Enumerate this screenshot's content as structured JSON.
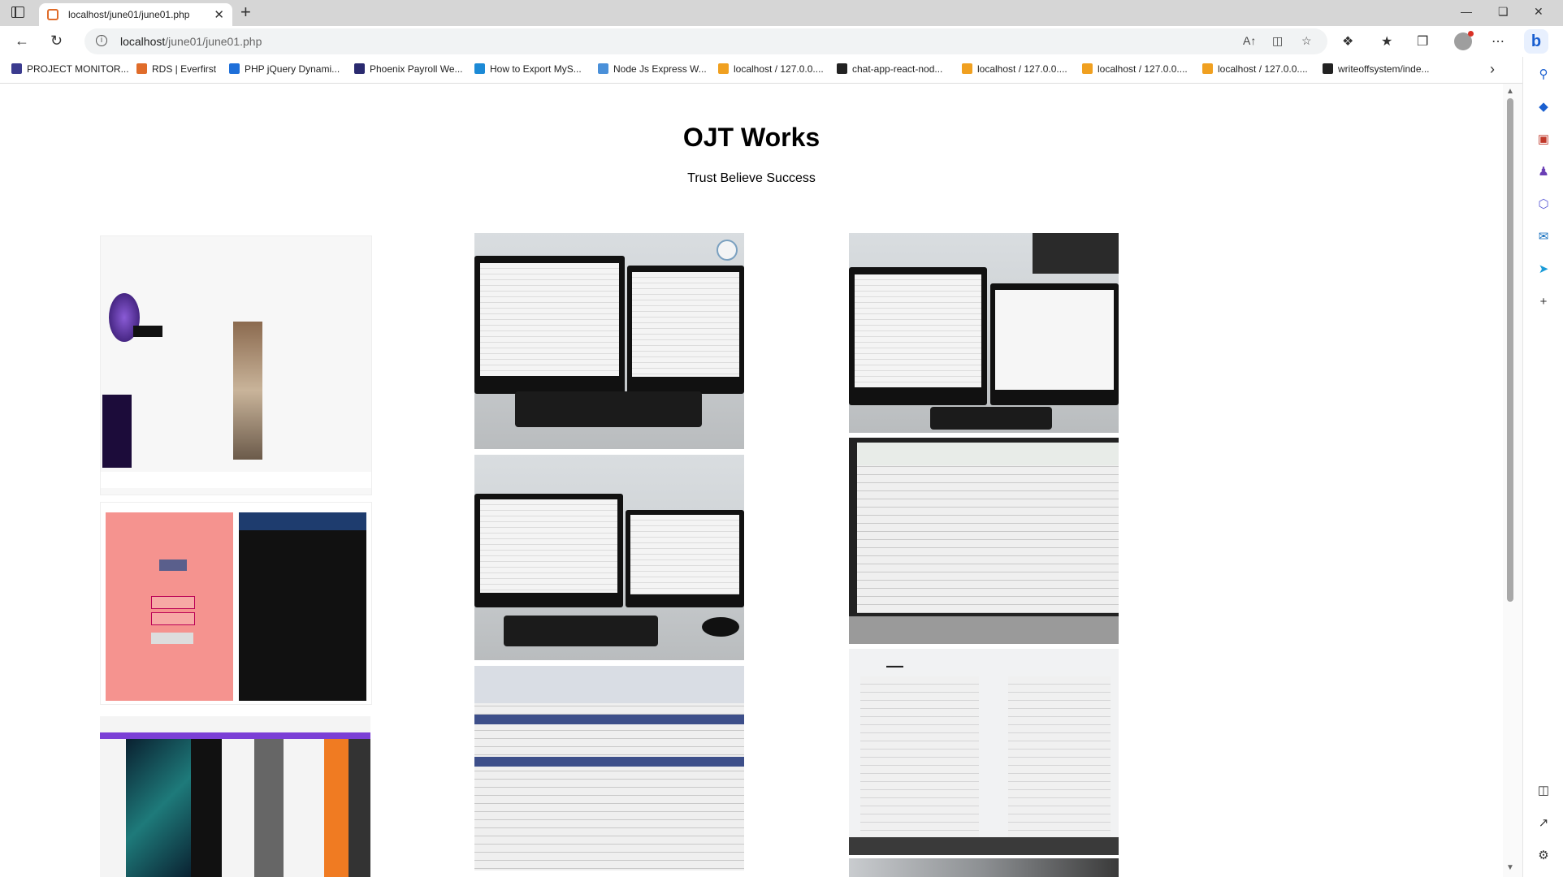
{
  "browser": {
    "tab_title": "localhost/june01/june01.php",
    "url_host": "localhost",
    "url_path": "/june01/june01.php",
    "new_tab_symbol": "+",
    "tab_close_symbol": "✕"
  },
  "bookmarks": [
    {
      "label": "PROJECT MONITOR...",
      "color": "#3b3b8f"
    },
    {
      "label": "RDS | Everfirst",
      "color": "#e06c2a"
    },
    {
      "label": "PHP jQuery Dynami...",
      "color": "#1e6fd9"
    },
    {
      "label": "Phoenix Payroll We...",
      "color": "#2a2a6f"
    },
    {
      "label": "How to Export MyS...",
      "color": "#1c8ad6"
    },
    {
      "label": "Node Js Express W...",
      "color": "#4a90d9"
    },
    {
      "label": "localhost / 127.0.0....",
      "color": "#f0a020"
    },
    {
      "label": "chat-app-react-nod...",
      "color": "#222222"
    },
    {
      "label": "localhost / 127.0.0....",
      "color": "#f0a020"
    },
    {
      "label": "localhost / 127.0.0....",
      "color": "#f0a020"
    },
    {
      "label": "localhost / 127.0.0....",
      "color": "#f0a020"
    },
    {
      "label": "writeoffsystem/inde...",
      "color": "#222222"
    }
  ],
  "page": {
    "title": "OJT Works",
    "subtitle": "Trust Believe Success"
  }
}
